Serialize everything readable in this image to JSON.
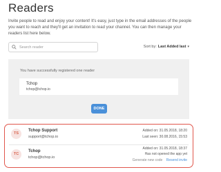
{
  "page": {
    "title": "Readers",
    "intro": "Invite people to read and enjoy your content! It's easy, just type in the email addresses of the people you want to reach and they'll get an invitation to read your channel. You can then manage your readers list here below."
  },
  "search": {
    "placeholder": "Search reader"
  },
  "sort": {
    "label": "Sort by:",
    "value": "Last Added last",
    "icon": "chevron-down-icon"
  },
  "success_panel": {
    "message": "You have successfully registered one reader",
    "reader_name": "Tchop",
    "reader_email": "tchop@tchop.io",
    "done_label": "DONE",
    "accent": "#4a90d9"
  },
  "readers": [
    {
      "initials": "TS",
      "name": "Tchop Support",
      "email": "support@tchop.io",
      "line1": "Added on: 31.05.2018, 18:20",
      "line2": "Last seen: 30.08.2016, 15:53"
    },
    {
      "initials": "TC",
      "name": "Tchop",
      "email": "tchop@tchop.io",
      "line1": "Added on: 31.05.2018, 18:37",
      "line2": "Has not opened the app yet",
      "action_generate": "Generate new code",
      "action_resend": "Resend invite"
    }
  ],
  "colors": {
    "highlight_border": "#e0554a",
    "avatar_bg": "#f7e3e1",
    "avatar_text": "#d9644f",
    "panel_bg": "#f0f0f0"
  }
}
